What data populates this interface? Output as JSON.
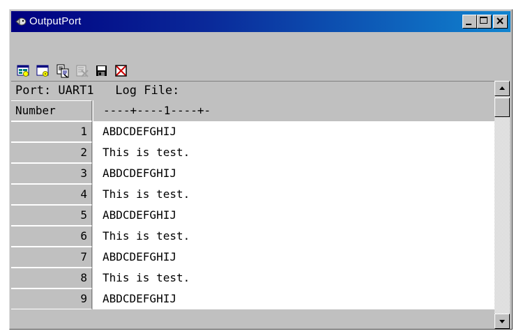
{
  "window": {
    "title": "OutputPort"
  },
  "titlebar": {
    "buttons": [
      "minimize",
      "maximize",
      "close"
    ]
  },
  "toolbar": {
    "tools": [
      {
        "icon": "connect-port-icon"
      },
      {
        "icon": "port-settings-icon"
      },
      {
        "icon": "copy-log-icon"
      },
      {
        "icon": "clear-log-icon"
      },
      {
        "icon": "save-icon"
      },
      {
        "icon": "close-log-icon"
      }
    ]
  },
  "logbar": {
    "text": "Port: UART1   Log File:"
  },
  "grid": {
    "header": {
      "number": "Number",
      "ruler": "----+----1----+-"
    },
    "rows": [
      {
        "n": "1",
        "text": "ABDCDEFGHIJ"
      },
      {
        "n": "2",
        "text": "This is test."
      },
      {
        "n": "3",
        "text": "ABDCDEFGHIJ"
      },
      {
        "n": "4",
        "text": "This is test."
      },
      {
        "n": "5",
        "text": "ABDCDEFGHIJ"
      },
      {
        "n": "6",
        "text": "This is test."
      },
      {
        "n": "7",
        "text": "ABDCDEFGHIJ"
      },
      {
        "n": "8",
        "text": "This is test."
      },
      {
        "n": "9",
        "text": "ABDCDEFGHIJ"
      }
    ]
  },
  "colors": {
    "title_start": "#000080",
    "title_end": "#1084d0",
    "face": "#c0c0c0"
  }
}
